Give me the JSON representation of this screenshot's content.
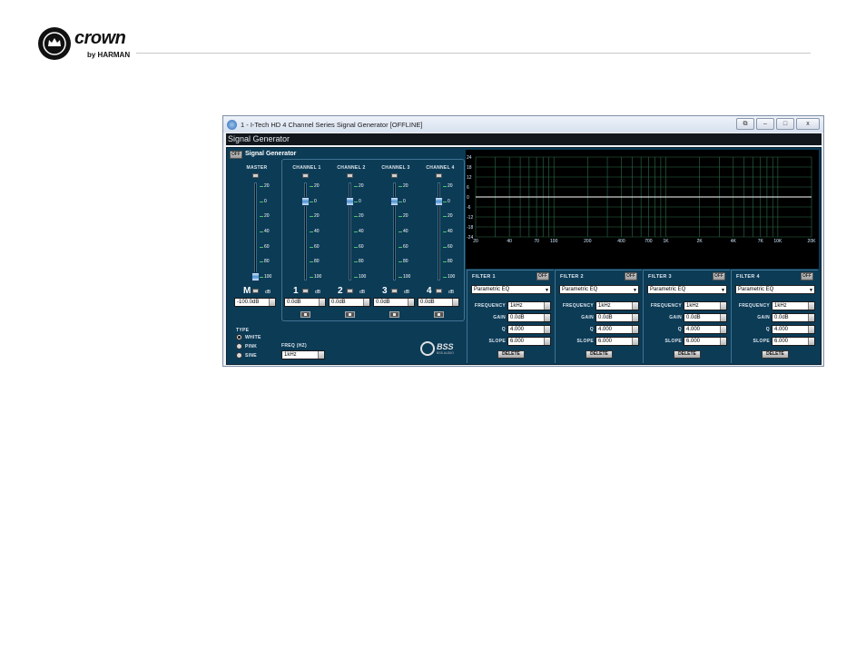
{
  "brand": {
    "name": "crown",
    "sub": "by HARMAN"
  },
  "window": {
    "title": "1 - I-Tech HD 4 Channel Series Signal Generator [OFFLINE]",
    "header": "Signal Generator",
    "minimize": "–",
    "maximize": "□",
    "close": "x"
  },
  "panel": {
    "off_label": "OFF",
    "title": "Signal Generator",
    "master": {
      "label": "MASTER",
      "number": "M",
      "value": "-100.0dB",
      "level_db": -100
    },
    "channels": [
      {
        "label": "CHANNEL 1",
        "number": "1",
        "value": "0.0dB",
        "level_db": 0
      },
      {
        "label": "CHANNEL 2",
        "number": "2",
        "value": "0.0dB",
        "level_db": 0
      },
      {
        "label": "CHANNEL 3",
        "number": "3",
        "value": "0.0dB",
        "level_db": 0
      },
      {
        "label": "CHANNEL 4",
        "number": "4",
        "value": "0.0dB",
        "level_db": 0
      }
    ],
    "scale": [
      "20",
      "0",
      "20",
      "40",
      "60",
      "80",
      "100"
    ],
    "db_unit": "dB",
    "type": {
      "label": "TYPE",
      "options": [
        "WHITE",
        "PINK",
        "SINE"
      ],
      "selected": "WHITE"
    },
    "freq": {
      "label": "FREQ (HZ)",
      "value": "1kHz"
    },
    "logo": {
      "mark": "BSS",
      "sub": "BSS AUDIO"
    }
  },
  "graph": {
    "y_ticks": [
      "24",
      "18",
      "12",
      "6",
      "0",
      "-6",
      "-12",
      "-18",
      "-24"
    ],
    "x_ticks": [
      "20",
      "40",
      "70",
      "100",
      "200",
      "400",
      "700",
      "1K",
      "2K",
      "4K",
      "7K",
      "10K",
      "20K"
    ],
    "colors": {
      "bg": "#000000",
      "grid": "#2c6e4a",
      "curve": "#ffffff",
      "text": "#cfe9ff"
    }
  },
  "filters": [
    {
      "title": "FILTER 1",
      "off": "OFF",
      "type": "Parametric EQ",
      "frequency_label": "FREQUENCY",
      "frequency": "1kHz",
      "gain_label": "GAIN",
      "gain": "0.0dB",
      "q_label": "Q",
      "q": "4.000",
      "slope_label": "SLOPE",
      "slope": "6.000",
      "delete": "DELETE"
    },
    {
      "title": "FILTER 2",
      "off": "OFF",
      "type": "Parametric EQ",
      "frequency_label": "FREQUENCY",
      "frequency": "1kHz",
      "gain_label": "GAIN",
      "gain": "0.0dB",
      "q_label": "Q",
      "q": "4.000",
      "slope_label": "SLOPE",
      "slope": "6.000",
      "delete": "DELETE"
    },
    {
      "title": "FILTER 3",
      "off": "OFF",
      "type": "Parametric EQ",
      "frequency_label": "FREQUENCY",
      "frequency": "1kHz",
      "gain_label": "GAIN",
      "gain": "0.0dB",
      "q_label": "Q",
      "q": "4.000",
      "slope_label": "SLOPE",
      "slope": "6.000",
      "delete": "DELETE"
    },
    {
      "title": "FILTER 4",
      "off": "OFF",
      "type": "Parametric EQ",
      "frequency_label": "FREQUENCY",
      "frequency": "1kHz",
      "gain_label": "GAIN",
      "gain": "0.0dB",
      "q_label": "Q",
      "q": "4.000",
      "slope_label": "SLOPE",
      "slope": "6.000",
      "delete": "DELETE"
    }
  ]
}
